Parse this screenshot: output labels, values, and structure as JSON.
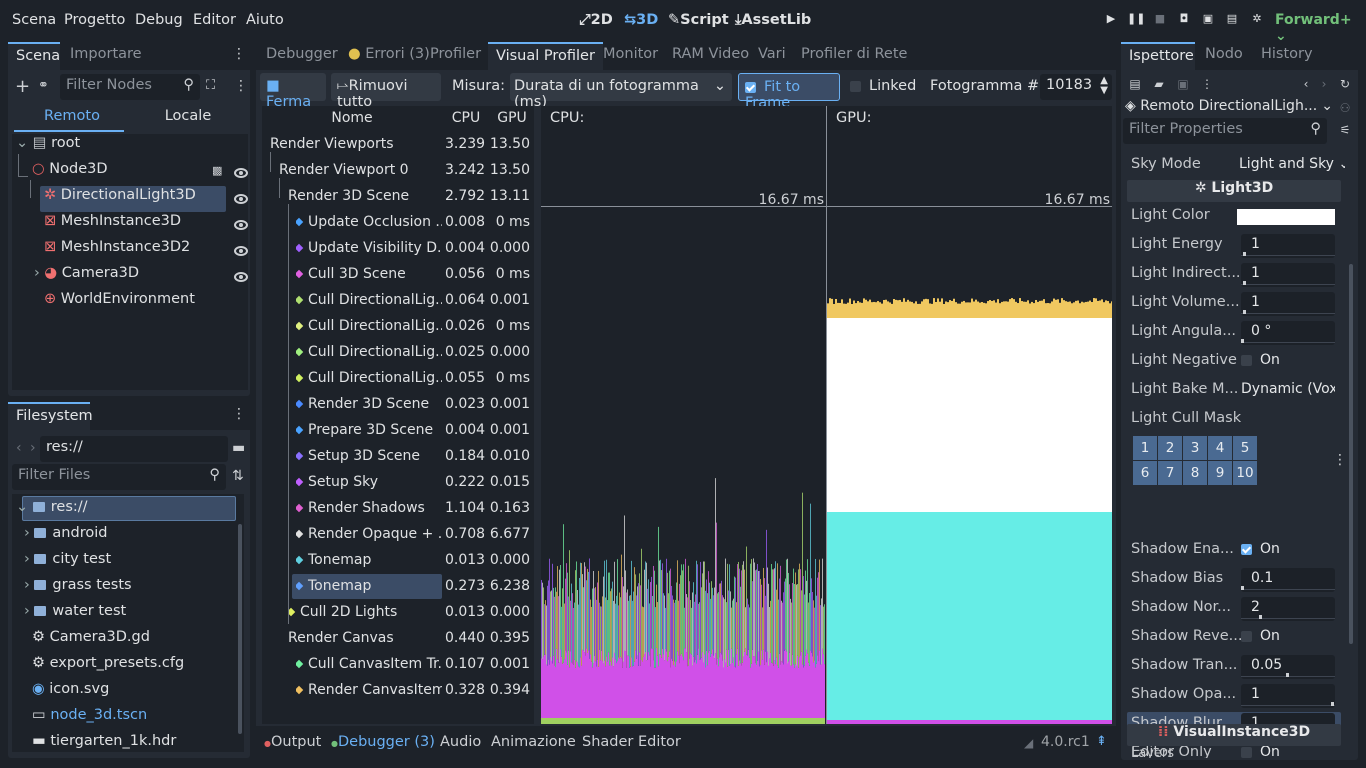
{
  "menu": [
    "Scena",
    "Progetto",
    "Debug",
    "Editor",
    "Aiuto"
  ],
  "workspaces": [
    {
      "label": "2D",
      "icon": "2d-icon"
    },
    {
      "label": "3D",
      "icon": "3d-icon"
    },
    {
      "label": "Script",
      "icon": "script-icon"
    },
    {
      "label": "AssetLib",
      "icon": "assetlib-icon"
    }
  ],
  "renderer": "Forward+",
  "scene_panel": {
    "tabs": [
      "Scena",
      "Importare"
    ],
    "filter_placeholder": "Filter Nodes",
    "remote_label": "Remoto",
    "local_label": "Locale",
    "nodes": [
      {
        "name": "root",
        "depth": 0
      },
      {
        "name": "Node3D",
        "depth": 1
      },
      {
        "name": "DirectionalLight3D",
        "depth": 2
      },
      {
        "name": "MeshInstance3D",
        "depth": 2
      },
      {
        "name": "MeshInstance3D2",
        "depth": 2
      },
      {
        "name": "Camera3D",
        "depth": 2
      },
      {
        "name": "WorldEnvironment",
        "depth": 2
      }
    ]
  },
  "filesystem": {
    "tab": "Filesystem",
    "path": "res://",
    "filter_placeholder": "Filter Files",
    "items": [
      "res://",
      "android",
      "city test",
      "grass tests",
      "water test",
      "Camera3D.gd",
      "export_presets.cfg",
      "icon.svg",
      "node_3d.tscn",
      "tiergarten_1k.hdr"
    ]
  },
  "debugger": {
    "tabs": [
      "Debugger",
      "Errori (3)",
      "Profiler",
      "Visual Profiler",
      "Monitor",
      "RAM Video",
      "Vari",
      "Profiler di Rete"
    ],
    "stop_label": "Ferma",
    "clear_label": "Rimuovi tutto",
    "measure_label": "Misura:",
    "measure_value": "Durata di un fotogramma (ms)",
    "fit_label": "Fit to Frame",
    "linked_label": "Linked",
    "frame_label": "Fotogramma #:",
    "frame_value": "10183",
    "columns": [
      "Nome",
      "CPU",
      "GPU"
    ],
    "rows": [
      {
        "name": "Render Viewports",
        "cpu": "3.239",
        "gpu": "13.50",
        "indent": 0,
        "color": ""
      },
      {
        "name": "Render Viewport 0",
        "cpu": "3.242",
        "gpu": "13.50",
        "indent": 1,
        "color": ""
      },
      {
        "name": "Render 3D Scene",
        "cpu": "2.792",
        "gpu": "13.11",
        "indent": 2,
        "color": ""
      },
      {
        "name": "Update Occlusion ...",
        "cpu": "0.008",
        "gpu": "0 ms",
        "indent": 3,
        "color": "#4aa3ff"
      },
      {
        "name": "Update Visibility D...",
        "cpu": "0.004",
        "gpu": "0.000",
        "indent": 3,
        "color": "#a060ff"
      },
      {
        "name": "Cull 3D Scene",
        "cpu": "0.056",
        "gpu": "0 ms",
        "indent": 3,
        "color": "#e060e0"
      },
      {
        "name": "Cull DirectionalLig...",
        "cpu": "0.064",
        "gpu": "0.001",
        "indent": 3,
        "color": "#b0e070"
      },
      {
        "name": "Cull DirectionalLig...",
        "cpu": "0.026",
        "gpu": "0 ms",
        "indent": 3,
        "color": "#e0f080"
      },
      {
        "name": "Cull DirectionalLig...",
        "cpu": "0.025",
        "gpu": "0.000",
        "indent": 3,
        "color": "#a0f080"
      },
      {
        "name": "Cull DirectionalLig...",
        "cpu": "0.055",
        "gpu": "0 ms",
        "indent": 3,
        "color": "#d0f060"
      },
      {
        "name": "Render 3D Scene",
        "cpu": "0.023",
        "gpu": "0.001",
        "indent": 3,
        "color": "#4a8aff"
      },
      {
        "name": "Prepare 3D Scene",
        "cpu": "0.004",
        "gpu": "0.001",
        "indent": 3,
        "color": "#4aa3ff"
      },
      {
        "name": "Setup 3D Scene",
        "cpu": "0.184",
        "gpu": "0.010",
        "indent": 3,
        "color": "#8a70ff"
      },
      {
        "name": "Setup Sky",
        "cpu": "0.222",
        "gpu": "0.015",
        "indent": 3,
        "color": "#c060ff"
      },
      {
        "name": "Render Shadows",
        "cpu": "1.104",
        "gpu": "0.163",
        "indent": 3,
        "color": "#e060d0"
      },
      {
        "name": "Render Opaque + ...",
        "cpu": "0.708",
        "gpu": "6.677",
        "indent": 3,
        "color": "#e0e0e0"
      },
      {
        "name": "Tonemap",
        "cpu": "0.013",
        "gpu": "0.000",
        "indent": 3,
        "color": "#60d0e0"
      },
      {
        "name": "Tonemap",
        "cpu": "0.273",
        "gpu": "6.238",
        "indent": 3,
        "color": "#60a0ff",
        "selected": true
      },
      {
        "name": "Cull 2D Lights",
        "cpu": "0.013",
        "gpu": "0.000",
        "indent": 2,
        "color": "#e0f060"
      },
      {
        "name": "Render Canvas",
        "cpu": "0.440",
        "gpu": "0.395",
        "indent": 2,
        "color": ""
      },
      {
        "name": "Cull CanvasItem Tr...",
        "cpu": "0.107",
        "gpu": "0.001",
        "indent": 3,
        "color": "#70f0a0"
      },
      {
        "name": "Render CanvasItems",
        "cpu": "0.328",
        "gpu": "0.394",
        "indent": 3,
        "color": "#f0c060"
      }
    ],
    "cpu_label": "CPU:",
    "gpu_label": "GPU:",
    "cpu_ms": "16.67 ms",
    "gpu_ms": "16.67 ms"
  },
  "bottom_tabs": [
    "Output",
    "Debugger (3)",
    "Audio",
    "Animazione",
    "Shader Editor"
  ],
  "version": "4.0.rc1",
  "inspector": {
    "tabs": [
      "Ispettore",
      "Nodo",
      "History"
    ],
    "object": "Remoto DirectionalLigh...",
    "filter_placeholder": "Filter Properties",
    "sky_mode_label": "Sky Mode",
    "sky_mode_value": "Light and Sky",
    "section_light": "Light3D",
    "props": [
      {
        "label": "Light Color",
        "value": "",
        "type": "color"
      },
      {
        "label": "Light Energy",
        "value": "1",
        "type": "slider",
        "level": 0.02
      },
      {
        "label": "Light Indirect...",
        "value": "1",
        "type": "slider",
        "level": 0.02
      },
      {
        "label": "Light Volume...",
        "value": "1",
        "type": "slider",
        "level": 0.02
      },
      {
        "label": "Light Angula...",
        "value": "0 °",
        "type": "slider",
        "level": 0.0
      },
      {
        "label": "Light Negative",
        "value": "On",
        "type": "check",
        "checked": false
      },
      {
        "label": "Light Bake M...",
        "value": "Dynamic (Voxe",
        "type": "select"
      },
      {
        "label": "Light Cull Mask",
        "value": "",
        "type": "mask"
      }
    ],
    "mask": [
      "1",
      "2",
      "3",
      "4",
      "5",
      "6",
      "7",
      "8",
      "9",
      "10"
    ],
    "props2": [
      {
        "label": "Shadow Ena...",
        "value": "On",
        "type": "check",
        "checked": true
      },
      {
        "label": "Shadow Bias",
        "value": "0.1",
        "type": "slider",
        "level": 0.0
      },
      {
        "label": "Shadow Nor...",
        "value": "2",
        "type": "slider",
        "level": 0.2
      },
      {
        "label": "Shadow Reve...",
        "value": "On",
        "type": "check",
        "checked": false
      },
      {
        "label": "Shadow Tran...",
        "value": "0.05",
        "type": "slider",
        "level": 0.5
      },
      {
        "label": "Shadow Opa...",
        "value": "1",
        "type": "slider",
        "level": 1.0
      },
      {
        "label": "Shadow Blur",
        "value": "1",
        "type": "slider",
        "level": 0.1,
        "highlight": true
      },
      {
        "label": "Editor Only",
        "value": "On",
        "type": "check",
        "checked": false
      }
    ],
    "section_visual": "VisualInstance3D",
    "layers_label": "Layers"
  }
}
